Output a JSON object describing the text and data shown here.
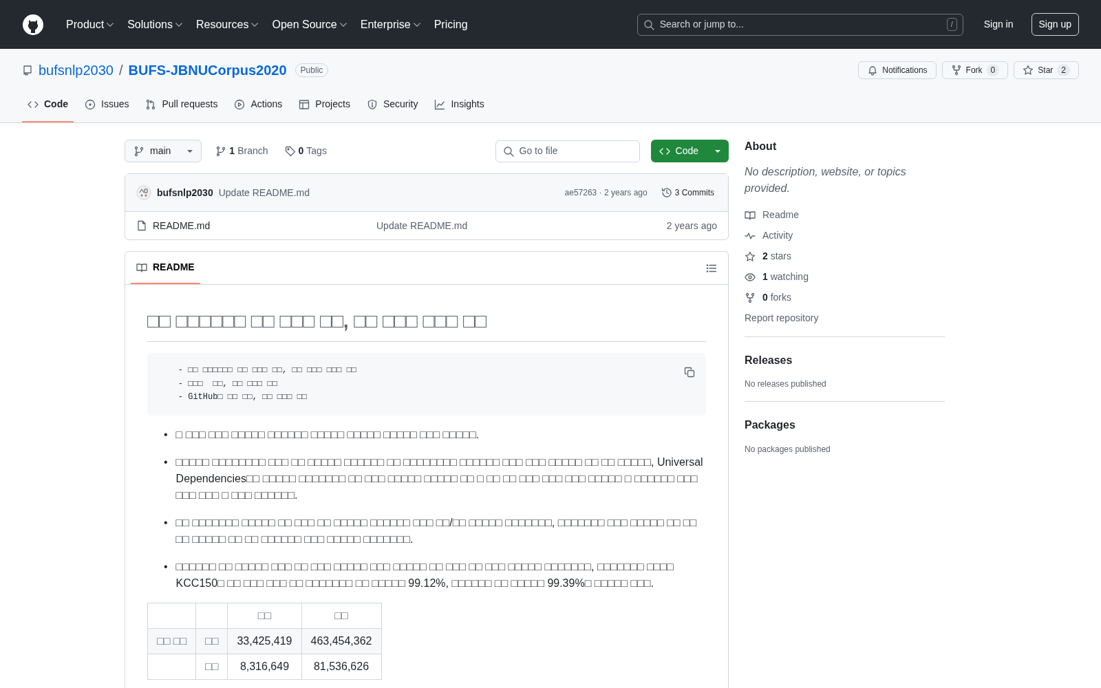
{
  "header": {
    "nav": [
      {
        "label": "Product",
        "dropdown": true
      },
      {
        "label": "Solutions",
        "dropdown": true
      },
      {
        "label": "Resources",
        "dropdown": true
      },
      {
        "label": "Open Source",
        "dropdown": true
      },
      {
        "label": "Enterprise",
        "dropdown": true
      },
      {
        "label": "Pricing",
        "dropdown": false
      }
    ],
    "search_placeholder": "Search or jump to...",
    "search_key": "/",
    "sign_in": "Sign in",
    "sign_up": "Sign up"
  },
  "repo": {
    "owner": "bufsnlp2030",
    "separator": "/",
    "name": "BUFS-JBNUCorpus2020",
    "visibility": "Public",
    "actions": [
      {
        "label": "Notifications"
      },
      {
        "label": "Fork",
        "count": "0"
      },
      {
        "label": "Star",
        "count": "2"
      }
    ]
  },
  "tabs": [
    {
      "label": "Code",
      "selected": true
    },
    {
      "label": "Issues",
      "selected": false
    },
    {
      "label": "Pull requests",
      "selected": false
    },
    {
      "label": "Actions",
      "selected": false
    },
    {
      "label": "Projects",
      "selected": false
    },
    {
      "label": "Security",
      "selected": false
    },
    {
      "label": "Insights",
      "selected": false
    }
  ],
  "toolbar": {
    "branch": "main",
    "branch_count": "1",
    "branch_label": "Branch",
    "tag_count": "0",
    "tag_label": "Tags",
    "go_to_file": "Go to file",
    "code_button": "Code"
  },
  "commit": {
    "author": "bufsnlp2030",
    "message": "Update README.md",
    "hash": "ae57263",
    "separator": "·",
    "time": "2 years ago",
    "commits": "3 Commits"
  },
  "files": [
    {
      "name": "README.md",
      "message": "Update README.md",
      "time": "2 years ago"
    }
  ],
  "readme": {
    "tab": "README",
    "heading": "□□ □□□□□□ □□ □□□ □□, □□ □□□ □□□ □□",
    "code_lines": [
      "    - □□ □□□□□□ □□ □□□ □□, □□ □□□ □□□ □□",
      "    - □□□  □□, □□ □□□ □□",
      "    - GitHub□ □□ □□, □□ □□□ □□"
    ],
    "bullets": [
      {
        "marker": "•",
        "text": "□ □□□ □□□ □□□□□ □□□□□□ □□□□□ □□□□□ □□□□□ □□□ □□□□□."
      },
      {
        "marker": "•",
        "text": "□□□□□ □□□□□□□□ □□□ □□ □□□□□ □□□□□□ □□ □□□□□□□□ □□□□□□ □□□ □□□ □□□□□ □□ □□ □□□□□, Universal Dependencies□□ □□□□□ □□□□□□□ □□ □□□ □□□□□ □□□□□ □□ □ □□ □□ □□□ □□□ □□□ □□□□□ □ □□□□□□ □□□ □□□ □□□ □ □□□ □□□□□□."
      },
      {
        "marker": "•",
        "text": "□□ □□□□□□□ □□□□□ □□ □□□ □□ □□□□□ □□□□□□ □□□ □□/□□ □□□□□ □□□□□□□, □□□□□□□ □□□ □□□□□ □□ □□ □□ □□□□□ □□ □□ □□□□□□ □□□ □□□□□ □□□□□□□."
      },
      {
        "marker": "•",
        "text": "□□□□□□ □□ □□□□□ □□□ □□ □□□ □□□□□ □□□ □□□□□ □□ □□□ □□ □□□ □□□□□ □□□□□□□, □□□□□□□ □□□□ KCC150□ □□ □□□ □□□ □□ □□□□□□□ □□ □□□□□ 99.12%, □□□□□□ □□ □□□□□ 99.39%□ □□□□□ □□□."
      }
    ],
    "table": {
      "columns": [
        "",
        "",
        "□□",
        "□□"
      ],
      "rows": [
        [
          "□□ □□",
          "□□",
          "33,425,419",
          "463,454,362"
        ],
        [
          "",
          "□□",
          "8,316,649",
          "81,536,626"
        ]
      ]
    }
  },
  "sidebar": {
    "about_title": "About",
    "description": "No description, website, or topics provided.",
    "items": [
      {
        "label": "Readme"
      },
      {
        "label": "Activity"
      },
      {
        "count": "2",
        "label": "stars"
      },
      {
        "count": "1",
        "label": "watching"
      },
      {
        "count": "0",
        "label": "forks"
      }
    ],
    "report": "Report repository",
    "releases_title": "Releases",
    "releases_text": "No releases published",
    "packages_title": "Packages",
    "packages_text": "No packages published"
  }
}
